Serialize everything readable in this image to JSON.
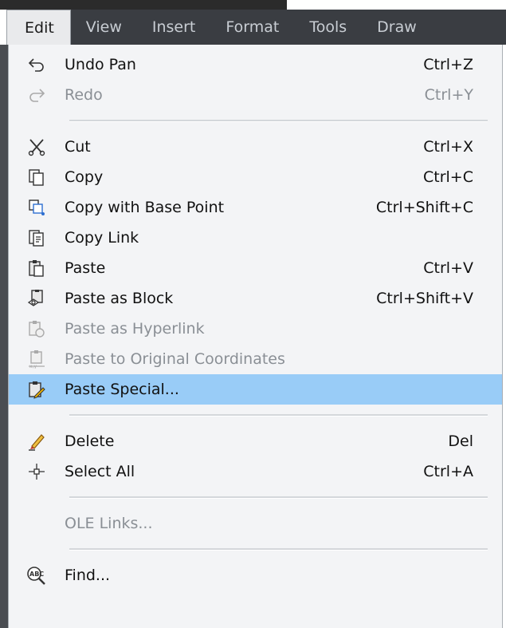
{
  "menubar": {
    "items": [
      {
        "label": "Edit",
        "active": true
      },
      {
        "label": "View"
      },
      {
        "label": "Insert"
      },
      {
        "label": "Format"
      },
      {
        "label": "Tools"
      },
      {
        "label": "Draw"
      }
    ]
  },
  "menu": {
    "groups": [
      [
        {
          "label": "Undo Pan",
          "shortcut": "Ctrl+Z",
          "icon": "undo-icon",
          "enabled": true
        },
        {
          "label": "Redo",
          "shortcut": "Ctrl+Y",
          "icon": "redo-icon",
          "enabled": false
        }
      ],
      [
        {
          "label": "Cut",
          "shortcut": "Ctrl+X",
          "icon": "scissors-icon",
          "enabled": true
        },
        {
          "label": "Copy",
          "shortcut": "Ctrl+C",
          "icon": "copy-icon",
          "enabled": true
        },
        {
          "label": "Copy with Base Point",
          "shortcut": "Ctrl+Shift+C",
          "icon": "copy-base-point-icon",
          "enabled": true
        },
        {
          "label": "Copy Link",
          "shortcut": "",
          "icon": "copy-link-icon",
          "enabled": true
        },
        {
          "label": "Paste",
          "shortcut": "Ctrl+V",
          "icon": "paste-icon",
          "enabled": true
        },
        {
          "label": "Paste as Block",
          "shortcut": "Ctrl+Shift+V",
          "icon": "paste-block-icon",
          "enabled": true
        },
        {
          "label": "Paste as Hyperlink",
          "shortcut": "",
          "icon": "paste-hyperlink-icon",
          "enabled": false
        },
        {
          "label": "Paste to Original Coordinates",
          "shortcut": "",
          "icon": "paste-coordinates-icon",
          "enabled": false
        },
        {
          "label": "Paste Special...",
          "shortcut": "",
          "icon": "paste-special-icon",
          "enabled": true,
          "highlighted": true
        }
      ],
      [
        {
          "label": "Delete",
          "shortcut": "Del",
          "icon": "eraser-icon",
          "enabled": true
        },
        {
          "label": "Select All",
          "shortcut": "Ctrl+A",
          "icon": "crosshair-icon",
          "enabled": true
        }
      ],
      [
        {
          "label": "OLE Links...",
          "shortcut": "",
          "icon": "",
          "enabled": false
        }
      ],
      [
        {
          "label": "Find...",
          "shortcut": "",
          "icon": "find-icon",
          "enabled": true
        }
      ]
    ]
  },
  "colors": {
    "menubar_bg": "#3a3d42",
    "menu_bg": "#f3f4f6",
    "highlight": "#99ccf7",
    "disabled_text": "#8a8f95"
  }
}
